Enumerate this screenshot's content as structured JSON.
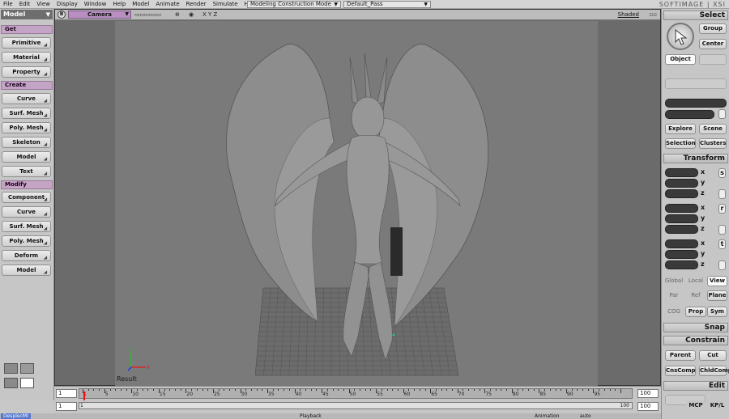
{
  "menubar": {
    "items": [
      "File",
      "Edit",
      "View",
      "Display",
      "Window",
      "Help",
      "Model",
      "Animate",
      "Render",
      "Simulate",
      "Hair"
    ],
    "construction_mode": "Modeling Construction Mode",
    "pass": "Default_Pass",
    "brand": "SOFTIMAGE | XSI"
  },
  "left_panel": {
    "mode": "Model",
    "sections": {
      "get": "Get",
      "create": "Create",
      "modify": "Modify"
    },
    "get_buttons": [
      "Primitive",
      "Material",
      "Property"
    ],
    "create_buttons": [
      "Curve",
      "Surf. Mesh",
      "Poly. Mesh",
      "Skeleton",
      "Model",
      "Text"
    ],
    "modify_buttons": [
      "Component",
      "Curve",
      "Surf. Mesh",
      "Poly. Mesh",
      "Deform",
      "Model"
    ]
  },
  "viewport": {
    "letter": "B",
    "camera": "Camera",
    "axis_letters": "X Y Z",
    "shading": "Shaded",
    "result_label": "Result"
  },
  "right_panel": {
    "select_header": "Select",
    "group": "Group",
    "center": "Center",
    "object": "Object",
    "explore": "Explore",
    "scene": "Scene",
    "selection": "Selection",
    "clusters": "Clusters",
    "transform_header": "Transform",
    "axis_x": "x",
    "axis_y": "y",
    "axis_z": "z",
    "scale_icon": "s",
    "rotate_icon": "r",
    "translate_icon": "t",
    "global": "Global",
    "local": "Local",
    "view": "View",
    "par": "Par",
    "ref": "Ref",
    "plane": "Plane",
    "cog": "COG",
    "prop": "Prop",
    "sym": "Sym",
    "snap_header": "Snap",
    "constrain_header": "Constrain",
    "parent": "Parent",
    "cut": "Cut",
    "cnscomp": "CnsComp",
    "chldcomp": "ChldComp",
    "edit_header": "Edit",
    "mcp": "MCP",
    "kpl": "KP/L"
  },
  "timeline": {
    "start": "1",
    "end": "100",
    "range_start": "1",
    "range_end": "100",
    "range_start_left": "1",
    "ruler_labels": [
      "1",
      "5",
      "10",
      "15",
      "20",
      "25",
      "30",
      "35",
      "40",
      "45",
      "50",
      "55",
      "60",
      "65",
      "70",
      "75",
      "80",
      "85",
      "90",
      "95"
    ],
    "current_frame": 1
  },
  "bottom": {
    "desktop_tab": "DesplecMI",
    "playback": "Playback",
    "animation": "Animation",
    "auto": "auto"
  }
}
